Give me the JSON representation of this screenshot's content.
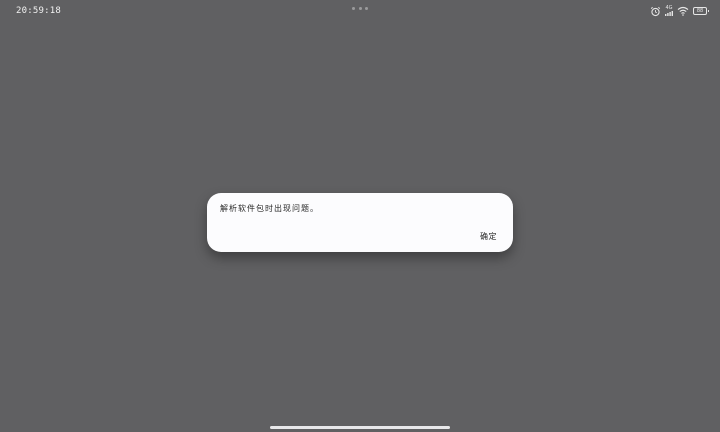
{
  "status_bar": {
    "time": "20:59:18",
    "network_text": "4G",
    "battery_level": "88"
  },
  "dialog": {
    "message": "解析软件包时出现问题。",
    "confirm_label": "确定"
  },
  "colors": {
    "scrim": "#606062",
    "dialog_background": "#fcfcfe",
    "text": "#2a2a2a"
  },
  "icons": [
    "alarm-icon",
    "cellular-signal-icon",
    "wifi-icon",
    "battery-icon"
  ]
}
